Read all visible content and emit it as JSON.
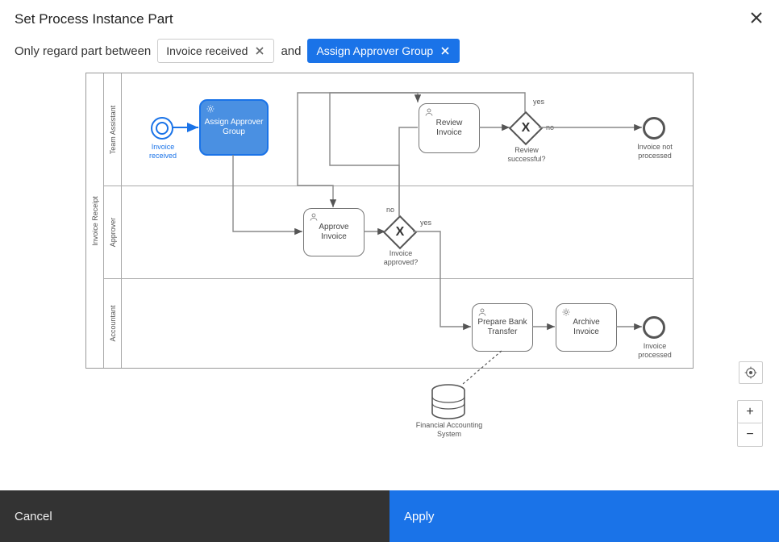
{
  "dialog": {
    "title": "Set Process Instance Part",
    "filter_prefix": "Only regard part between",
    "filter_connector": "and",
    "chip_start": "Invoice received",
    "chip_end": "Assign Approver Group"
  },
  "footer": {
    "cancel": "Cancel",
    "apply": "Apply"
  },
  "colors": {
    "accent": "#1a73e8",
    "selected_fill": "#4a90e2",
    "footer_dark": "#333333"
  },
  "pool": {
    "label": "Invoice Receipt",
    "lanes": [
      {
        "id": "team-assistant",
        "label": "Team Assistant"
      },
      {
        "id": "approver",
        "label": "Approver"
      },
      {
        "id": "accountant",
        "label": "Accountant"
      }
    ]
  },
  "nodes": {
    "start": {
      "label": "Invoice received",
      "selected": true,
      "type": "start-event"
    },
    "assign_approver": {
      "label": "Assign Approver Group",
      "selected": true,
      "type": "service-task",
      "icon": "gear-icon"
    },
    "review_invoice": {
      "label": "Review Invoice",
      "type": "user-task",
      "icon": "user-icon"
    },
    "gw_review": {
      "label": "Review successful?",
      "type": "exclusive-gateway"
    },
    "end_not_processed": {
      "label": "Invoice not processed",
      "type": "end-event"
    },
    "approve_invoice": {
      "label": "Approve Invoice",
      "type": "user-task",
      "icon": "user-icon"
    },
    "gw_approved": {
      "label": "Invoice approved?",
      "type": "exclusive-gateway"
    },
    "prepare_transfer": {
      "label": "Prepare Bank Transfer",
      "type": "user-task",
      "icon": "user-icon"
    },
    "archive_invoice": {
      "label": "Archive Invoice",
      "type": "service-task",
      "icon": "gear-icon"
    },
    "end_processed": {
      "label": "Invoice processed",
      "type": "end-event"
    },
    "data_store": {
      "label": "Financial Accounting System",
      "type": "data-store"
    }
  },
  "edge_labels": {
    "review_yes": "yes",
    "review_no": "no",
    "approved_yes": "yes",
    "approved_no": "no"
  }
}
